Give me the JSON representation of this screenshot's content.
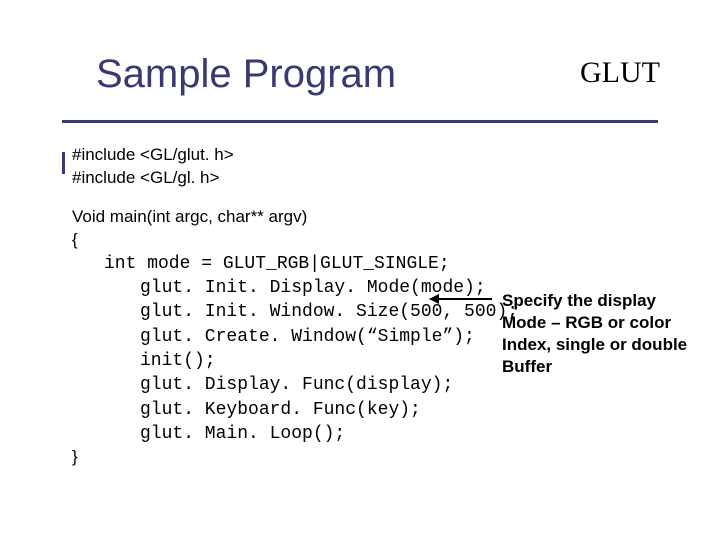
{
  "title": "Sample Program",
  "corner_label": "GLUT",
  "code": {
    "include1": "#include <GL/glut. h>",
    "include2": "#include <GL/gl. h>",
    "sig": "Void main(int argc, char** argv)",
    "brace_open": "{",
    "l1": "int mode = GLUT_RGB|GLUT_SINGLE;",
    "l2": "glut. Init. Display. Mode(mode);",
    "l3": "glut. Init. Window. Size(500, 500);",
    "l4": "glut. Create. Window(“Simple”);",
    "l5": "init();",
    "l6": "glut. Display. Func(display);",
    "l7": "glut. Keyboard. Func(key);",
    "l8": "glut. Main. Loop();",
    "brace_close": "}"
  },
  "annotation": {
    "l1": "Specify the display",
    "l2": "Mode – RGB or color",
    "l3": "Index, single or double",
    "l4": "Buffer"
  }
}
